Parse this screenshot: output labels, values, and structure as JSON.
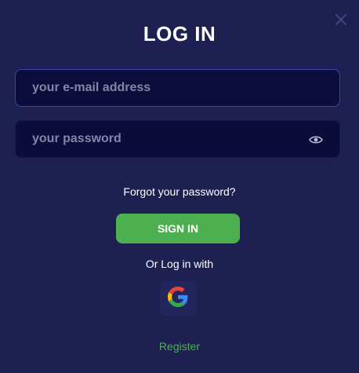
{
  "dialog": {
    "title": "LOG IN",
    "close_icon": "close-icon"
  },
  "form": {
    "email": {
      "value": "",
      "placeholder": "your e-mail address"
    },
    "password": {
      "value": "",
      "placeholder": "your password",
      "toggle_icon": "eye-icon"
    },
    "forgot_label": "Forgot your password?",
    "signin_label": "SIGN IN",
    "social_label": "Or Log in with",
    "social_icon": "google-icon",
    "register_label": "Register"
  },
  "colors": {
    "background": "#1f2052",
    "input_background": "#0b0c3a",
    "focused_border": "#3f45a8",
    "primary": "#4caf50",
    "text": "#ffffff",
    "placeholder": "#8485a6"
  }
}
